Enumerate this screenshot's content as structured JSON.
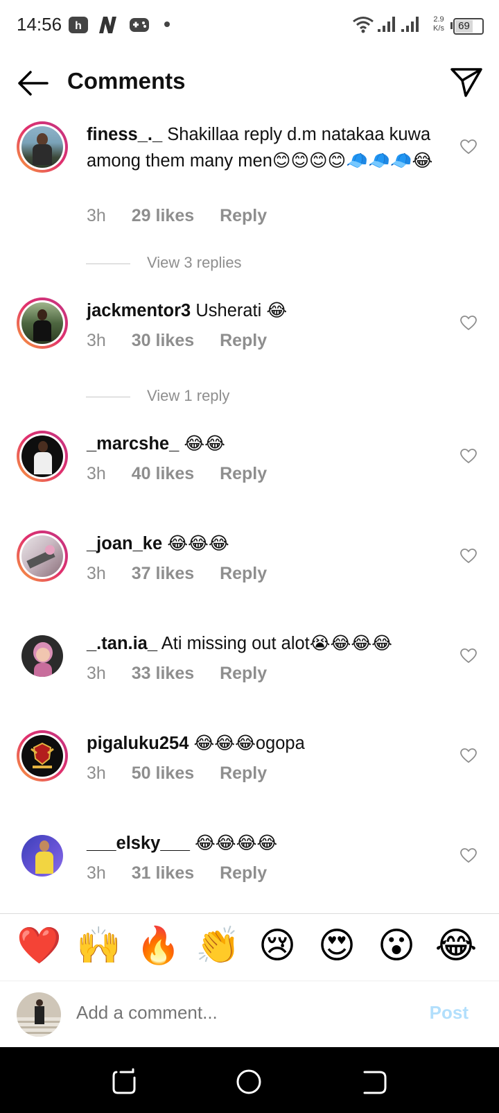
{
  "status": {
    "time": "14:56",
    "net_speed_top": "2.9",
    "net_speed_bottom": "K/s",
    "battery": "69"
  },
  "header": {
    "title": "Comments"
  },
  "comments": [
    {
      "user": "finess_._",
      "text": "Shakillaa reply d.m natakaa kuwa among them many men😊😊😊😊🧢🧢🧢😂",
      "time": "3h",
      "likes": "29 likes",
      "reply": "Reply"
    },
    {
      "user": "jackmentor3",
      "text": "Usherati 😂",
      "time": "3h",
      "likes": "30 likes",
      "reply": "Reply"
    },
    {
      "user": "_marcshe_",
      "text": "😂😂",
      "time": "3h",
      "likes": "40 likes",
      "reply": "Reply"
    },
    {
      "user": "_joan_ke",
      "text": "😂😂😂",
      "time": "3h",
      "likes": "37 likes",
      "reply": "Reply"
    },
    {
      "user": "_.tan.ia_",
      "text": "Ati missing out alot😭😂😂😂",
      "time": "3h",
      "likes": "33 likes",
      "reply": "Reply"
    },
    {
      "user": "pigaluku254",
      "text": "😂😂😂ogopa",
      "time": "3h",
      "likes": "50 likes",
      "reply": "Reply"
    },
    {
      "user": "___elsky___",
      "text": "😂😂😂😂",
      "time": "3h",
      "likes": "31 likes",
      "reply": "Reply"
    }
  ],
  "view_replies": [
    "View 3 replies",
    "View 1 reply"
  ],
  "reactions": [
    "❤️",
    "🙌",
    "🔥",
    "👏",
    "😢",
    "😍",
    "😮",
    "😂"
  ],
  "composer": {
    "placeholder": "Add a comment...",
    "post_label": "Post"
  },
  "colors": {
    "meta_gray": "#8e8e8e",
    "post_blue_disabled": "#b2dffc",
    "story_ring": "#e1306c"
  }
}
